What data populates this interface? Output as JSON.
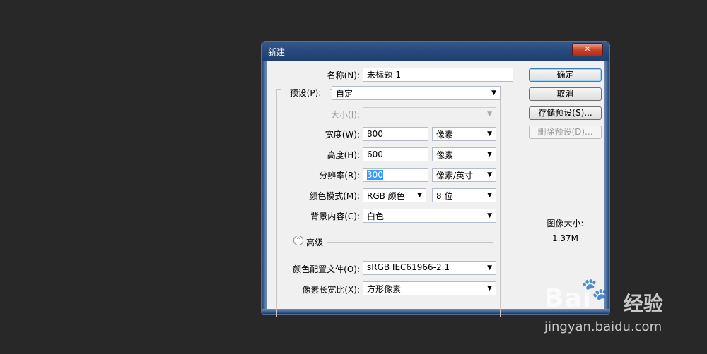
{
  "dialog": {
    "title": "新建",
    "close_glyph": "✕"
  },
  "form": {
    "name_label": "名称(N):",
    "name_value": "未标题-1",
    "preset_label": "预设(P):",
    "preset_value": "自定",
    "size_label": "大小(I):",
    "size_value": "",
    "width_label": "宽度(W):",
    "width_value": "800",
    "width_unit": "像素",
    "height_label": "高度(H):",
    "height_value": "600",
    "height_unit": "像素",
    "resolution_label": "分辨率(R):",
    "resolution_value": "300",
    "resolution_unit": "像素/英寸",
    "color_mode_label": "颜色模式(M):",
    "color_mode_value": "RGB 颜色",
    "bit_depth_value": "8 位",
    "background_label": "背景内容(C):",
    "background_value": "白色",
    "advanced_label": "高级",
    "advanced_icon": "chevron-up",
    "color_profile_label": "颜色配置文件(O):",
    "color_profile_value": "sRGB IEC61966-2.1",
    "pixel_aspect_label": "像素长宽比(X):",
    "pixel_aspect_value": "方形像素"
  },
  "buttons": {
    "ok": "确定",
    "cancel": "取消",
    "save_preset": "存储预设(S)...",
    "delete_preset": "删除预设(D)..."
  },
  "info": {
    "image_size_label": "图像大小:",
    "image_size_value": "1.37M"
  },
  "watermark": {
    "logo": "Bai",
    "logo_suffix": "经验",
    "url": "jingyan.baidu.com"
  },
  "colors": {
    "background": "#282828",
    "titlebar": "#294a7c",
    "close_button": "#c8452c",
    "selection": "#3399ff"
  }
}
